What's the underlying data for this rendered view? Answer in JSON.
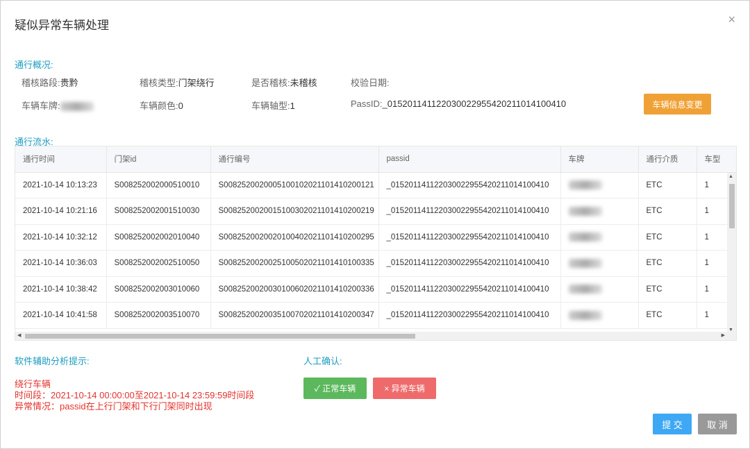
{
  "dialog": {
    "title": "疑似异常车辆处理",
    "close_glyph": "×"
  },
  "overview": {
    "label": "通行概况:",
    "row1": [
      {
        "key": "稽核路段:",
        "value": "贵黔"
      },
      {
        "key": "稽核类型:",
        "value": "门架绕行"
      },
      {
        "key": "是否稽核:",
        "value": "未稽核"
      },
      {
        "key": "校验日期:",
        "value": ""
      }
    ],
    "row2": [
      {
        "key": "车辆车牌:",
        "value": ""
      },
      {
        "key": "车辆颜色:",
        "value": "0"
      },
      {
        "key": "车辆轴型:",
        "value": "1"
      },
      {
        "key": "PassID:",
        "value": "_015201141122030022955420211014100410"
      }
    ],
    "change_button": "车辆信息变更"
  },
  "flow": {
    "label": "通行流水:",
    "columns": [
      "通行时间",
      "门架id",
      "通行编号",
      "passid",
      "车牌",
      "通行介质",
      "车型"
    ],
    "rows": [
      [
        "2021-10-14 10:13:23",
        "S008252002000510010",
        "S008252002000510010202110141020012​1",
        "_015201141122030022955420211014100410",
        "",
        "ETC",
        "1"
      ],
      [
        "2021-10-14 10:21:16",
        "S008252002001510030",
        "S0082520020015100302021101410200219",
        "_015201141122030022955420211014100410",
        "",
        "ETC",
        "1"
      ],
      [
        "2021-10-14 10:32:12",
        "S008252002002010040",
        "S0082520020020100402021101410200295",
        "_015201141122030022955420211014100410",
        "",
        "ETC",
        "1"
      ],
      [
        "2021-10-14 10:36:03",
        "S008252002002510050",
        "S0082520020025100502021101410100335",
        "_015201141122030022955420211014100410",
        "",
        "ETC",
        "1"
      ],
      [
        "2021-10-14 10:38:42",
        "S008252002003010060",
        "S0082520020030100602021101410200336",
        "_015201141122030022955420211014100410",
        "",
        "ETC",
        "1"
      ],
      [
        "2021-10-14 10:41:58",
        "S008252002003510070",
        "S0082520020035100702021101410200347",
        "_015201141122030022955420211014100410",
        "",
        "ETC",
        "1"
      ]
    ]
  },
  "analysis": {
    "label": "软件辅助分析提示:",
    "lines": [
      "绕行车辆",
      "时间段：2021-10-14 00:00:00至2021-10-14 23:59:59时间段",
      "异常情况：passid在上行门架和下行门架同时出现"
    ]
  },
  "manual": {
    "label": "人工确认:",
    "normal_button": "✓ 正常车辆",
    "abnormal_button": "× 异常车辆"
  },
  "footer": {
    "submit": "提 交",
    "cancel": "取 消"
  },
  "colors": {
    "accent": "#1c9cc1",
    "orange": "#f0a136",
    "green": "#5cb85c",
    "red": "#ef6b6b",
    "blue": "#3ea8f4",
    "alert": "#e5322d"
  }
}
